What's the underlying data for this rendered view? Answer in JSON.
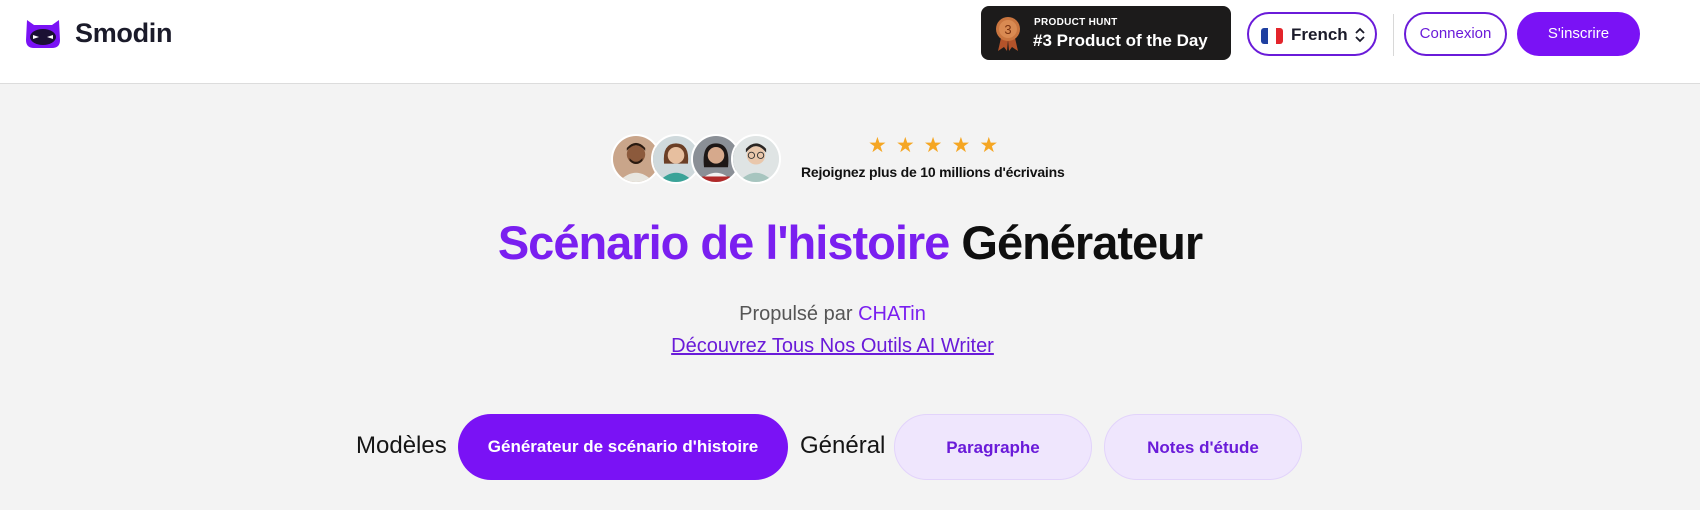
{
  "header": {
    "brand": "Smodin",
    "product_hunt": {
      "medal_number": "3",
      "small_label": "PRODUCT HUNT",
      "big_label": "#3 Product of the Day"
    },
    "language": {
      "label": "French",
      "flag_colors": [
        "#1f3fa0",
        "#ffffff",
        "#e3242b"
      ]
    },
    "login_label": "Connexion",
    "signup_label": "S'inscrire"
  },
  "hero": {
    "rating_stars": 5,
    "join_text": "Rejoignez plus de 10 millions d'écrivains",
    "title_part1": "Scénario de l'histoire",
    "title_part2": "Générateur",
    "powered_prefix": "Propulsé par",
    "powered_brand": "CHATin",
    "discover_link": "Découvrez Tous Nos Outils AI Writer"
  },
  "tabs": {
    "models_label": "Modèles",
    "active_tab": "Générateur de scénario d'histoire",
    "general_label": "Général",
    "items": [
      "Paragraphe",
      "Notes d'étude"
    ]
  },
  "colors": {
    "accent": "#7a12f5",
    "accent_soft": "#efe6fd",
    "star": "#f5a623",
    "page_bg": "#f3f3f3"
  }
}
